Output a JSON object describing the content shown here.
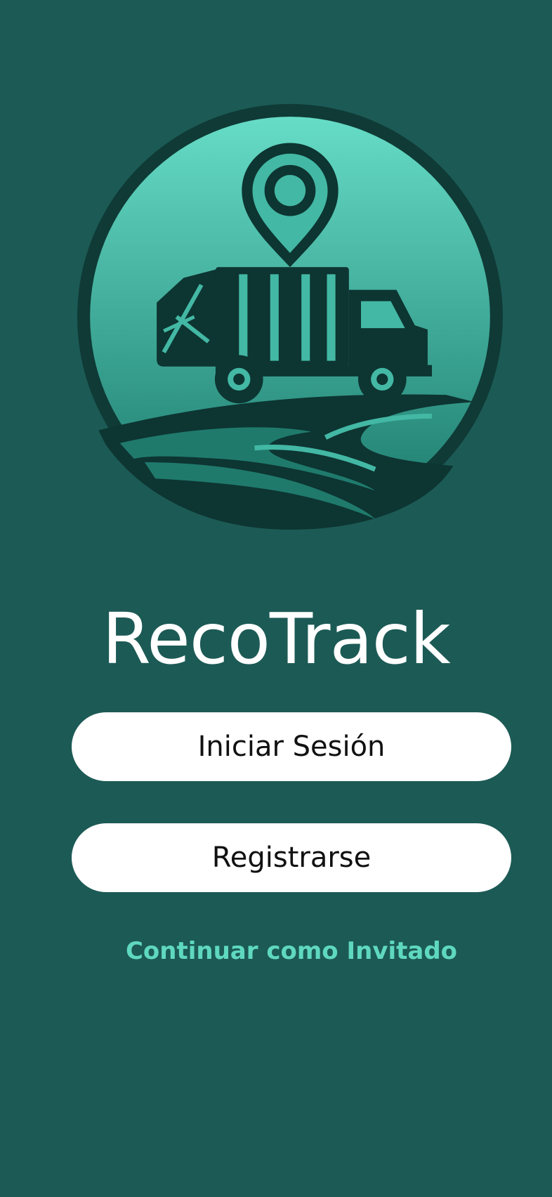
{
  "app": {
    "title": "RecoTrack"
  },
  "actions": {
    "login_label": "Iniciar Sesión",
    "register_label": "Registrarse",
    "guest_label": "Continuar como Invitado"
  },
  "logo": {
    "icon": "garbage-truck-location-icon"
  },
  "colors": {
    "background": "#1c5a55",
    "logo_light": "#63dcc4",
    "logo_dark": "#0d3532",
    "button": "#ffffff",
    "guest_link": "#5fd8c0"
  }
}
